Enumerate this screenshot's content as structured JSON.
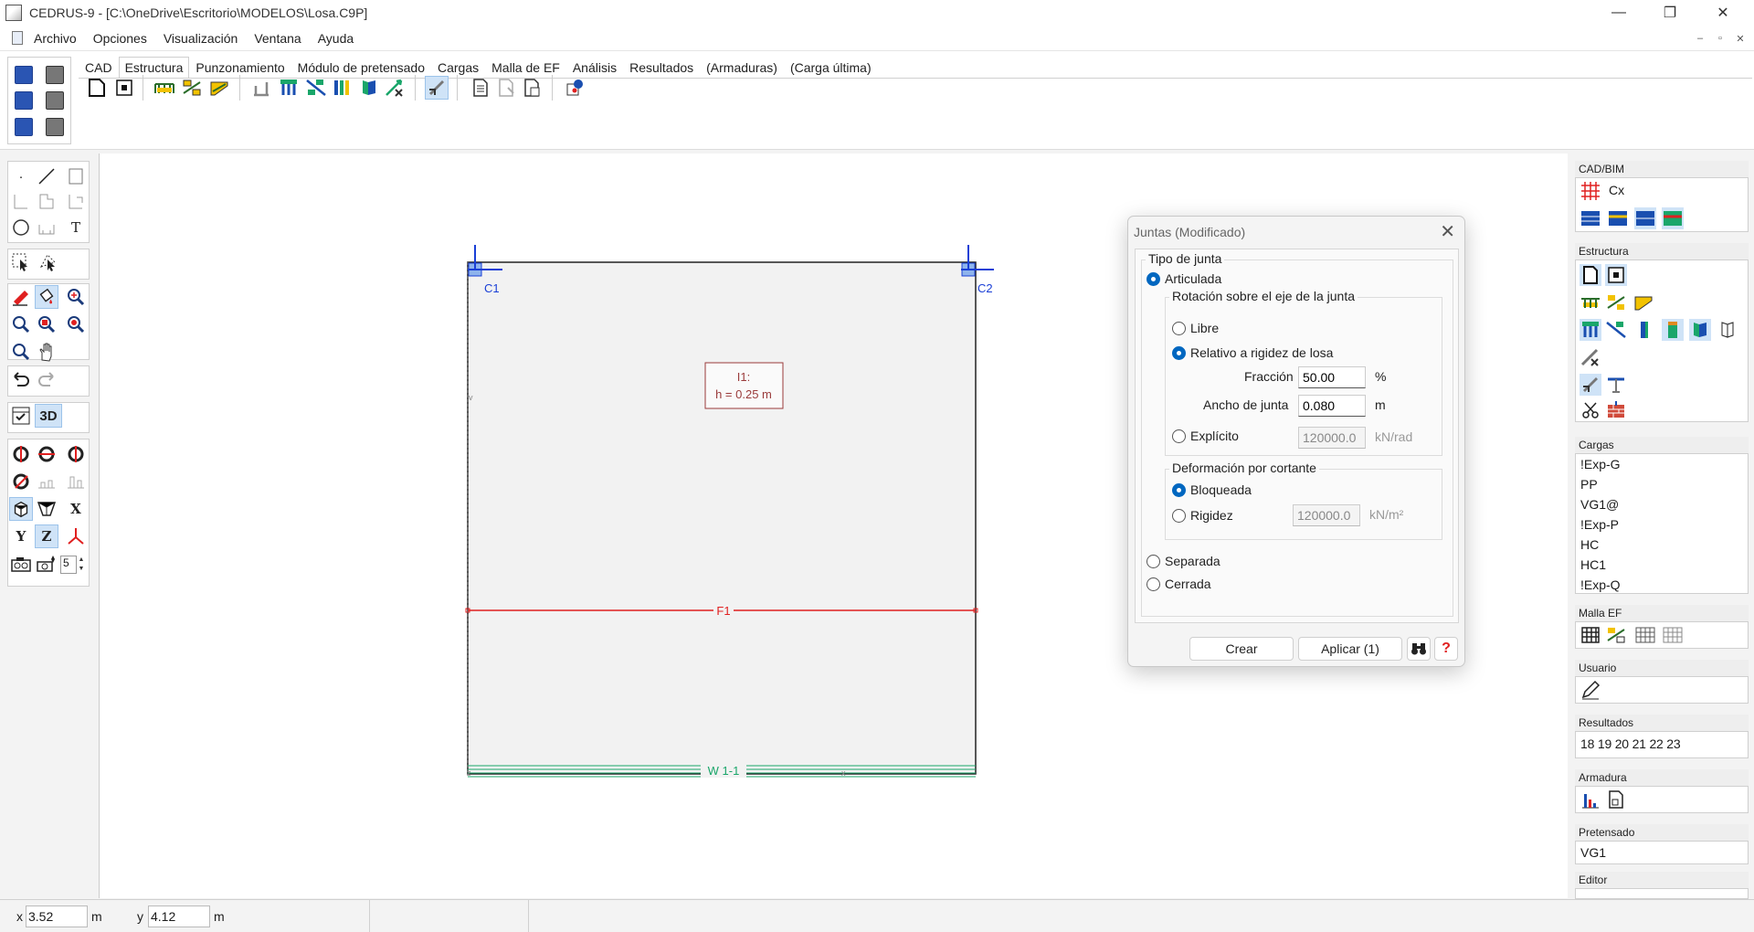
{
  "window": {
    "title": "CEDRUS-9 - [C:\\OneDrive\\Escritorio\\MODELOS\\Losa.C9P]",
    "minimize_glyph": "—",
    "restore_glyph": "❐",
    "close_glyph": "✕"
  },
  "menu": {
    "items": [
      "Archivo",
      "Opciones",
      "Visualización",
      "Ventana",
      "Ayuda"
    ],
    "mdi_min": "–",
    "mdi_restore": "▫",
    "mdi_close": "✕"
  },
  "ribbon": {
    "tabs": [
      "CAD",
      "Estructura",
      "Punzonamiento",
      "Módulo de pretensado",
      "Cargas",
      "Malla de EF",
      "Análisis",
      "Resultados",
      "(Armaduras)",
      "(Carga última)"
    ],
    "active_tab": "Estructura"
  },
  "left_toolbar": {
    "text_tool": "T",
    "view_3d": "3D",
    "axis_x": "X",
    "axis_y": "Y",
    "axis_z": "Z",
    "spinner_value": "5"
  },
  "canvas": {
    "column_c1": "C1",
    "column_c2": "C2",
    "slab_label_line1": "I1:",
    "slab_label_line2": "h = 0.25 m",
    "joint_label": "F1",
    "wall_label": "W 1-1",
    "small_mark_v": "v",
    "small_mark_z": "z",
    "small_mark_x": "x"
  },
  "right_panel": {
    "cadbim": {
      "header": "CAD/BIM",
      "label": "Cx"
    },
    "estructura": {
      "header": "Estructura"
    },
    "cargas": {
      "header": "Cargas",
      "items": [
        "!Exp-G",
        "PP",
        "VG1@",
        "!Exp-P",
        "HC",
        "HC1",
        "!Exp-Q"
      ]
    },
    "malla": {
      "header": "Malla EF"
    },
    "usuario": {
      "header": "Usuario"
    },
    "resultados": {
      "header": "Resultados",
      "value": "18 19 20 21 22 23"
    },
    "armadura": {
      "header": "Armadura"
    },
    "pretensado": {
      "header": "Pretensado",
      "value": "VG1"
    },
    "editor": {
      "header": "Editor"
    }
  },
  "dialog": {
    "title": "Juntas (Modificado)",
    "close_glyph": "✕",
    "group_tipo": "Tipo de junta",
    "opt_articulada": "Articulada",
    "group_rotacion": "Rotación sobre el eje de la junta",
    "opt_libre": "Libre",
    "opt_relativo": "Relativo a rigidez de losa",
    "label_fraccion": "Fracción",
    "value_fraccion": "50.00",
    "unit_fraccion": "%",
    "label_ancho": "Ancho de junta",
    "value_ancho": "0.080",
    "unit_ancho": "m",
    "opt_explicito": "Explícito",
    "value_explicito": "120000.0",
    "unit_explicito": "kN/rad",
    "group_deformacion": "Deformación por cortante",
    "opt_bloqueada": "Bloqueada",
    "opt_rigidez": "Rigidez",
    "value_rigidez": "120000.0",
    "unit_rigidez": "kN/m²",
    "opt_separada": "Separada",
    "opt_cerrada": "Cerrada",
    "btn_crear": "Crear",
    "btn_aplicar": "Aplicar (1)",
    "btn_help": "?"
  },
  "status": {
    "x_label": "x",
    "x_value": "3.52",
    "x_unit": "m",
    "y_label": "y",
    "y_value": "4.12",
    "y_unit": "m"
  },
  "colors": {
    "accent": "#0067c0",
    "column_blue": "#1a3fd6",
    "joint_red": "#e02020",
    "wall_green": "#1aa66a",
    "slab_fill": "#f2f2f2",
    "label_brown": "#9a3b3b"
  }
}
